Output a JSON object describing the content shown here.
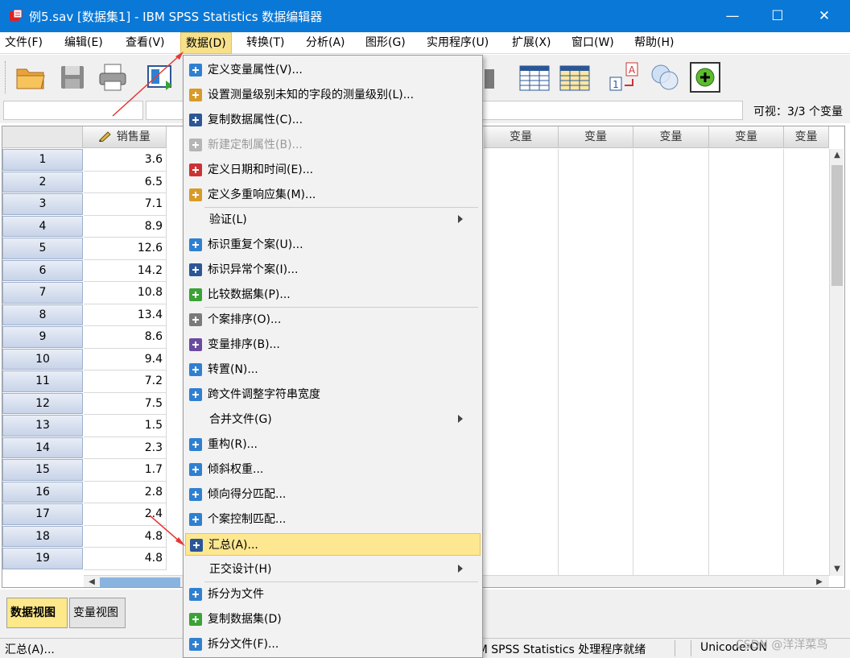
{
  "window": {
    "title": "例5.sav [数据集1] - IBM SPSS Statistics 数据编辑器",
    "minimize": "—",
    "maximize": "☐",
    "close": "✕"
  },
  "menubar": {
    "items": [
      "文件(F)",
      "编辑(E)",
      "查看(V)",
      "数据(D)",
      "转换(T)",
      "分析(A)",
      "图形(G)",
      "实用程序(U)",
      "扩展(X)",
      "窗口(W)",
      "帮助(H)"
    ],
    "active": "数据(D)"
  },
  "toolbar": {
    "buttons": [
      "open-folder-icon",
      "save-icon",
      "print-icon",
      "recall-dialog-icon",
      "weight-icon",
      "table-icon",
      "value-labels-icon",
      "ab-12-icon",
      "sets-icon",
      "add-icon"
    ]
  },
  "cellbar": {
    "visible_count": "可视：3/3 个变量"
  },
  "grid": {
    "first_column": "销售量",
    "empty_column": "变量",
    "rows": [
      {
        "n": "1",
        "v": "3.6"
      },
      {
        "n": "2",
        "v": "6.5"
      },
      {
        "n": "3",
        "v": "7.1"
      },
      {
        "n": "4",
        "v": "8.9"
      },
      {
        "n": "5",
        "v": "12.6"
      },
      {
        "n": "6",
        "v": "14.2"
      },
      {
        "n": "7",
        "v": "10.8"
      },
      {
        "n": "8",
        "v": "13.4"
      },
      {
        "n": "9",
        "v": "8.6"
      },
      {
        "n": "10",
        "v": "9.4"
      },
      {
        "n": "11",
        "v": "7.2"
      },
      {
        "n": "12",
        "v": "7.5"
      },
      {
        "n": "13",
        "v": "1.5"
      },
      {
        "n": "14",
        "v": "2.3"
      },
      {
        "n": "15",
        "v": "1.7"
      },
      {
        "n": "16",
        "v": "2.8"
      },
      {
        "n": "17",
        "v": "2.4"
      },
      {
        "n": "18",
        "v": "4.8"
      },
      {
        "n": "19",
        "v": "4.8"
      }
    ]
  },
  "tabs": {
    "data_view": "数据视图",
    "variable_view": "变量视图"
  },
  "statusbar": {
    "left": "汇总(A)...",
    "processor": "IBM SPSS Statistics 处理程序就绪",
    "unicode": "Unicode:ON"
  },
  "watermark": "CSDN @洋洋菜鸟",
  "dropdown": {
    "items": [
      {
        "label": "定义变量属性(V)...",
        "icon": "define-variable-properties-icon"
      },
      {
        "label": "设置测量级别未知的字段的测量级别(L)...",
        "icon": "set-measurement-level-icon"
      },
      {
        "label": "复制数据属性(C)...",
        "icon": "copy-data-properties-icon"
      },
      {
        "label": "新建定制属性(B)...",
        "icon": "new-custom-attribute-icon",
        "disabled": true
      },
      {
        "label": "定义日期和时间(E)...",
        "icon": "date-time-icon"
      },
      {
        "label": "定义多重响应集(M)...",
        "icon": "multiple-response-icon"
      },
      {
        "label": "验证(L)",
        "submenu": true
      },
      {
        "label": "标识重复个案(U)...",
        "icon": "identify-duplicates-icon"
      },
      {
        "label": "标识异常个案(I)...",
        "icon": "identify-unusual-icon"
      },
      {
        "label": "比较数据集(P)...",
        "icon": "compare-datasets-icon"
      },
      {
        "label": "个案排序(O)...",
        "icon": "sort-cases-icon"
      },
      {
        "label": "变量排序(B)...",
        "icon": "sort-variables-icon"
      },
      {
        "label": "转置(N)...",
        "icon": "transpose-icon"
      },
      {
        "label": "跨文件调整字符串宽度",
        "icon": "adjust-string-width-icon"
      },
      {
        "label": "合并文件(G)",
        "submenu": true
      },
      {
        "label": "重构(R)...",
        "icon": "restructure-icon"
      },
      {
        "label": "倾斜权重...",
        "icon": "rake-weights-icon"
      },
      {
        "label": "倾向得分匹配...",
        "icon": "propensity-matching-icon"
      },
      {
        "label": "个案控制匹配...",
        "icon": "case-control-icon"
      },
      {
        "label": "汇总(A)...",
        "icon": "aggregate-icon",
        "highlighted": true
      },
      {
        "label": "正交设计(H)",
        "submenu": true
      },
      {
        "label": "拆分为文件",
        "icon": "split-into-files-icon"
      },
      {
        "label": "复制数据集(D)",
        "icon": "copy-dataset-icon"
      },
      {
        "label": "拆分文件(F)...",
        "icon": "split-file-icon"
      }
    ]
  },
  "colors": {
    "titlebar": "#0a78d7",
    "menu_highlight": "#fde791",
    "annotation_arrow": "#e53935"
  }
}
